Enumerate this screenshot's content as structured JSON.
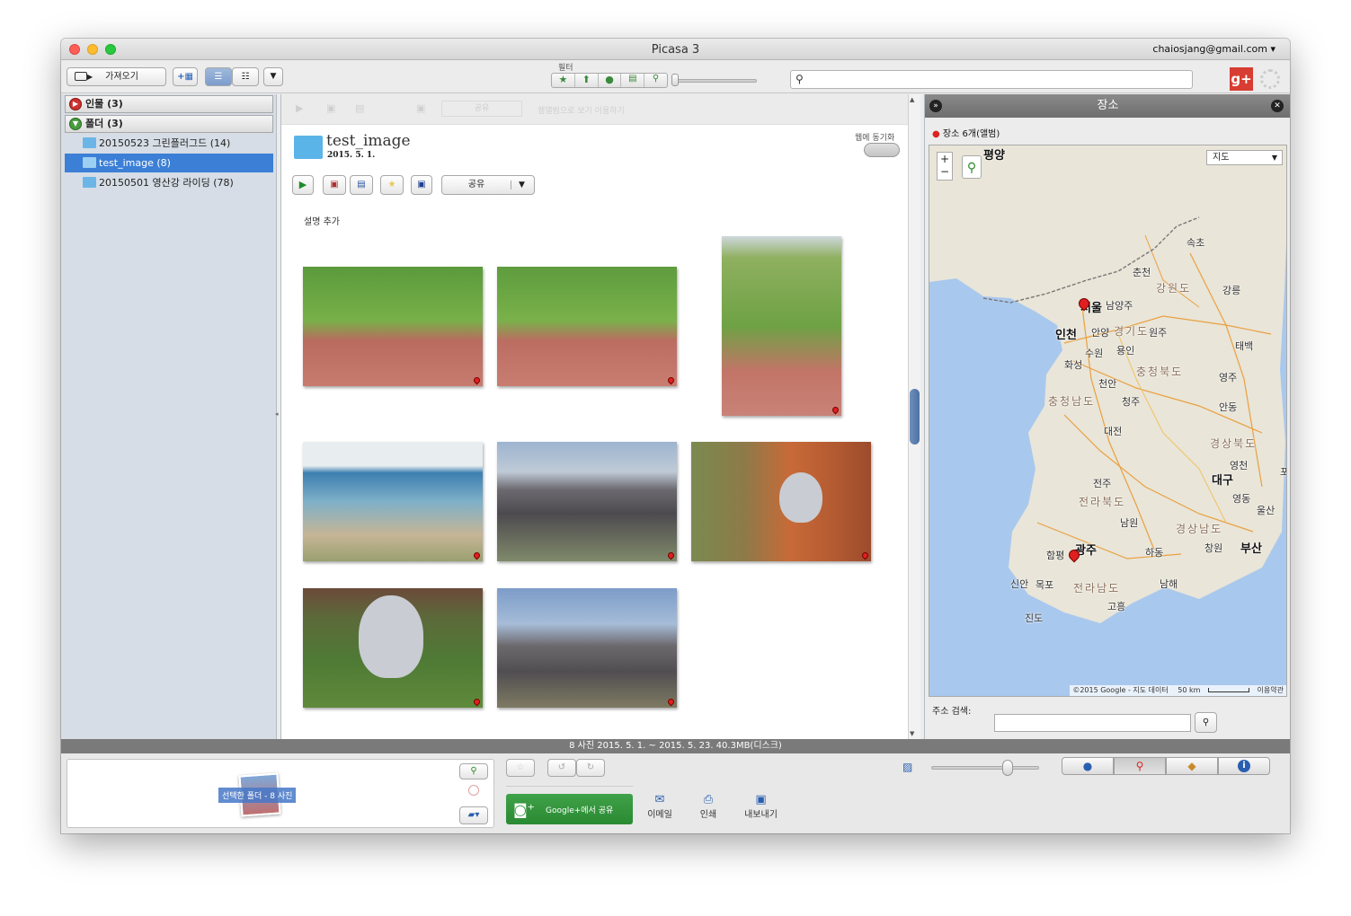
{
  "window": {
    "title": "Picasa 3",
    "account": "chaiosjang@gmail.com"
  },
  "toolbar": {
    "import_label": "가져오기",
    "filter_label": "필터",
    "search_placeholder": ""
  },
  "sidebar": {
    "people_header": "인물 (3)",
    "folders_header": "폴더 (3)",
    "items": [
      {
        "label": "20150523 그린플러그드 (14)",
        "selected": false
      },
      {
        "label": "test_image (8)",
        "selected": true
      },
      {
        "label": "20150501 영산강 라이딩 (78)",
        "selected": false
      }
    ]
  },
  "main": {
    "disabled_share_label": "공유",
    "disabled_hint": "웹앨범으로 보기 이용하기",
    "folder_title": "test_image",
    "folder_date": "2015. 5. 1.",
    "sync_label": "웹에 동기화",
    "share_label": "공유",
    "description_placeholder": "설명 추가"
  },
  "places": {
    "title": "장소",
    "count_label": "장소 6개(앨범)",
    "map_type": "지도",
    "copyright": "©2015 Google - 지도 데이터",
    "scale": "50 km",
    "terms": "이용약관",
    "address_label": "주소 검색:",
    "labels": [
      "평양",
      "속초",
      "춘천",
      "강원도",
      "강릉",
      "서울",
      "남양주",
      "인천",
      "안양",
      "경기도",
      "원주",
      "수원",
      "용인",
      "화성",
      "충청북도",
      "태백",
      "천안",
      "영주",
      "충청남도",
      "청주",
      "안동",
      "대전",
      "경상북도",
      "영천",
      "대구",
      "전주",
      "전라북도",
      "영동",
      "울산",
      "남원",
      "경상남도",
      "광주",
      "함평",
      "하동",
      "창원",
      "부산",
      "신안",
      "목포",
      "전라남도",
      "남해",
      "진도",
      "고흥",
      "포"
    ]
  },
  "status": {
    "text": "8 사진    2015. 5. 1. ~ 2015. 5. 23.    40.3MB(디스크)"
  },
  "bottom": {
    "tray_label": "선택한 폴더 - 8 사진",
    "share_gplus": "Google+에서 공유",
    "email": "이메일",
    "print": "인쇄",
    "export": "내보내기"
  },
  "colors": {
    "accent": "#3b82d6",
    "selection": "#3c7fd6",
    "green": "#2e8b36",
    "pin": "#e02020"
  }
}
